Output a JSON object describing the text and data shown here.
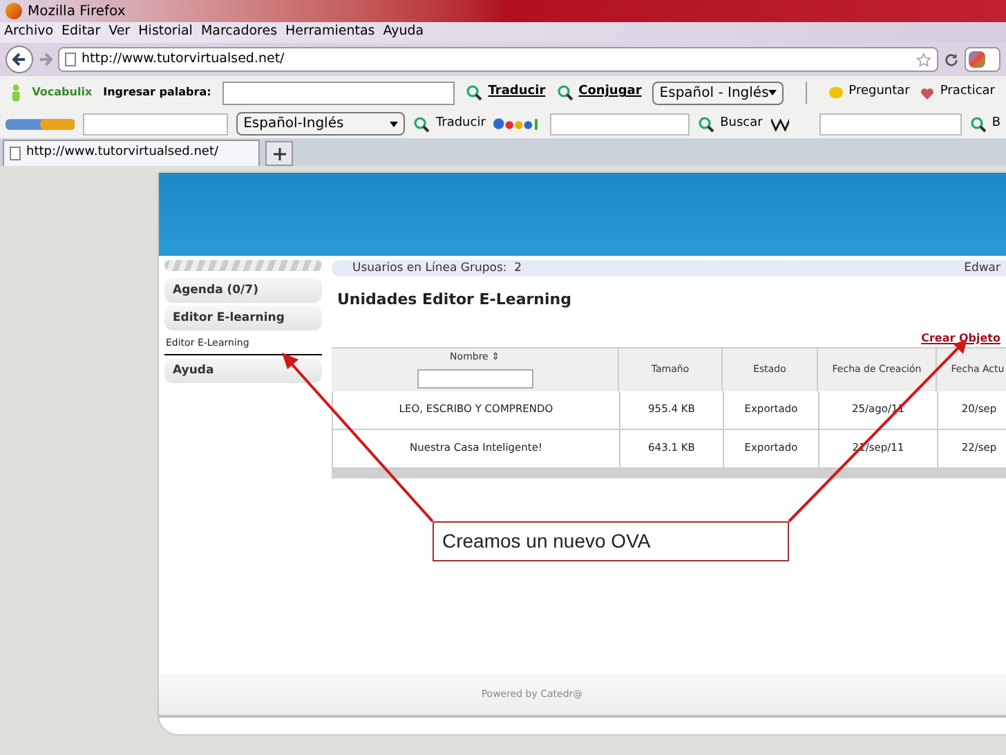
{
  "window": {
    "title": "Mozilla Firefox"
  },
  "menu": [
    "Archivo",
    "Editar",
    "Ver",
    "Historial",
    "Marcadores",
    "Herramientas",
    "Ayuda"
  ],
  "nav": {
    "url": "http://www.tutorvirtualsed.net/"
  },
  "vocabulix": {
    "brand": "Vocabulix",
    "label": "Ingresar palabra:",
    "translate": "Traducir",
    "conjugate": "Conjugar",
    "language": "Español - Inglés",
    "ask": "Preguntar",
    "practice": "Practicar"
  },
  "babla": {
    "language": "Español-Inglés",
    "translate": "Traducir",
    "search": "Buscar",
    "wiki_button": "B"
  },
  "tabs": [
    {
      "label": "http://www.tutorvirtualsed.net/",
      "selected": true
    }
  ],
  "page": {
    "online": "Usuarios en Línea Grupos:  2",
    "user": "Edwar",
    "sidebar": [
      {
        "label": "Agenda (0/7)",
        "kind": "section"
      },
      {
        "label": "Editor E-learning",
        "kind": "section"
      },
      {
        "label": "Editor E-Learning",
        "kind": "link"
      },
      {
        "label": "Ayuda",
        "kind": "section"
      }
    ],
    "heading": "Unidades Editor E-Learning",
    "create_link": "Crear Objeto",
    "table": {
      "columns": [
        "Nombre ⇕",
        "Tamaño",
        "Estado",
        "Fecha de Creación",
        "Fecha Actu"
      ],
      "rows": [
        [
          "LEO, ESCRIBO Y COMPRENDO",
          "955.4 KB",
          "Exportado",
          "25/ago/11",
          "20/sep"
        ],
        [
          "Nuestra Casa Inteligente!",
          "643.1 KB",
          "Exportado",
          "21/sep/11",
          "22/sep"
        ]
      ]
    },
    "footer": "Powered by Catedr@"
  },
  "callout": "Creamos un nuevo OVA"
}
